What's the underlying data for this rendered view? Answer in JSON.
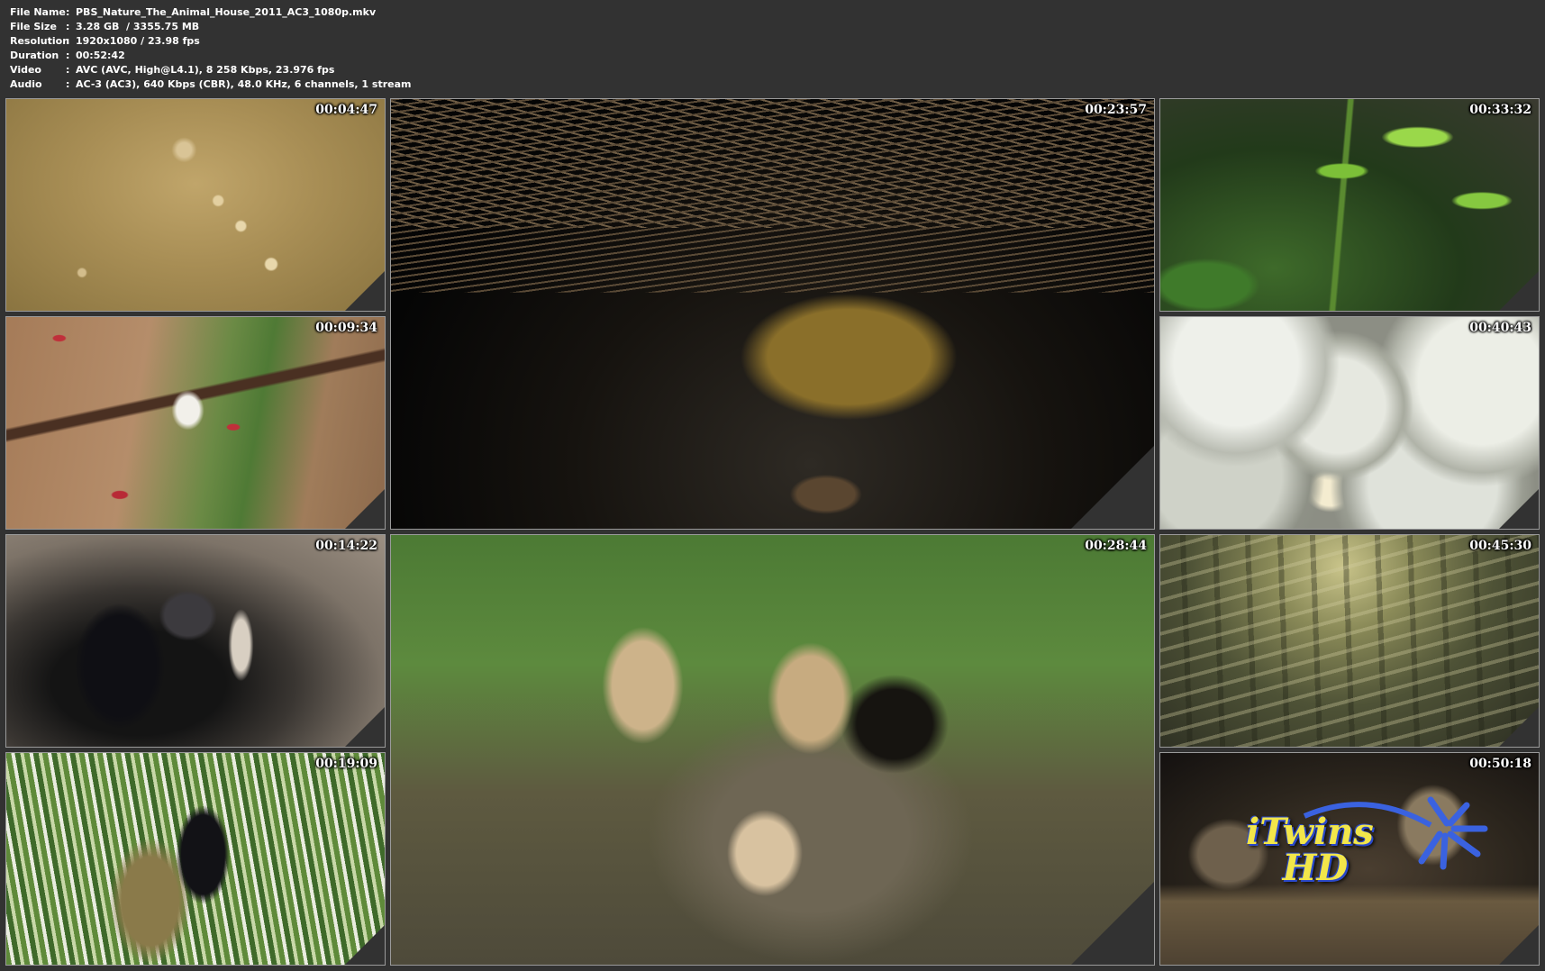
{
  "info": {
    "rows": [
      {
        "key": "File Name",
        "value": "PBS_Nature_The_Animal_House_2011_AC3_1080p.mkv"
      },
      {
        "key": "File Size",
        "value": "3.28 GB  / 3355.75 MB"
      },
      {
        "key": "Resolution",
        "value": "1920x1080 / 23.98 fps"
      },
      {
        "key": "Duration",
        "value": "00:52:42"
      },
      {
        "key": "Video",
        "value": "AVC (AVC, High@L4.1), 8 258 Kbps, 23.976 fps"
      },
      {
        "key": "Audio",
        "value": "AC-3 (AC3), 640 Kbps (CBR), 48.0 KHz, 6 channels, 1 stream"
      }
    ],
    "separator": ":"
  },
  "thumbnails": [
    {
      "timestamp": "00:04:47",
      "scene": "aerial-savanna"
    },
    {
      "timestamp": "00:09:34",
      "scene": "eagle-cliff-bee-eaters"
    },
    {
      "timestamp": "00:14:22",
      "scene": "swallows-mud-nest"
    },
    {
      "timestamp": "00:19:09",
      "scene": "weaver-bird-reeds"
    },
    {
      "timestamp": "00:23:57",
      "scene": "bowerbird-under-twigs"
    },
    {
      "timestamp": "00:28:44",
      "scene": "burrowing-owl-chicks"
    },
    {
      "timestamp": "00:33:32",
      "scene": "bamboo-leaves"
    },
    {
      "timestamp": "00:40:43",
      "scene": "foam-egg-clusters"
    },
    {
      "timestamp": "00:45:30",
      "scene": "sunlit-forest-floor"
    },
    {
      "timestamp": "00:50:18",
      "scene": "prairie-dog-burrow"
    }
  ],
  "watermark": {
    "line1": "iTwins",
    "line2": "HD",
    "color": "#f2e64a",
    "outline": "#2a48c8"
  }
}
